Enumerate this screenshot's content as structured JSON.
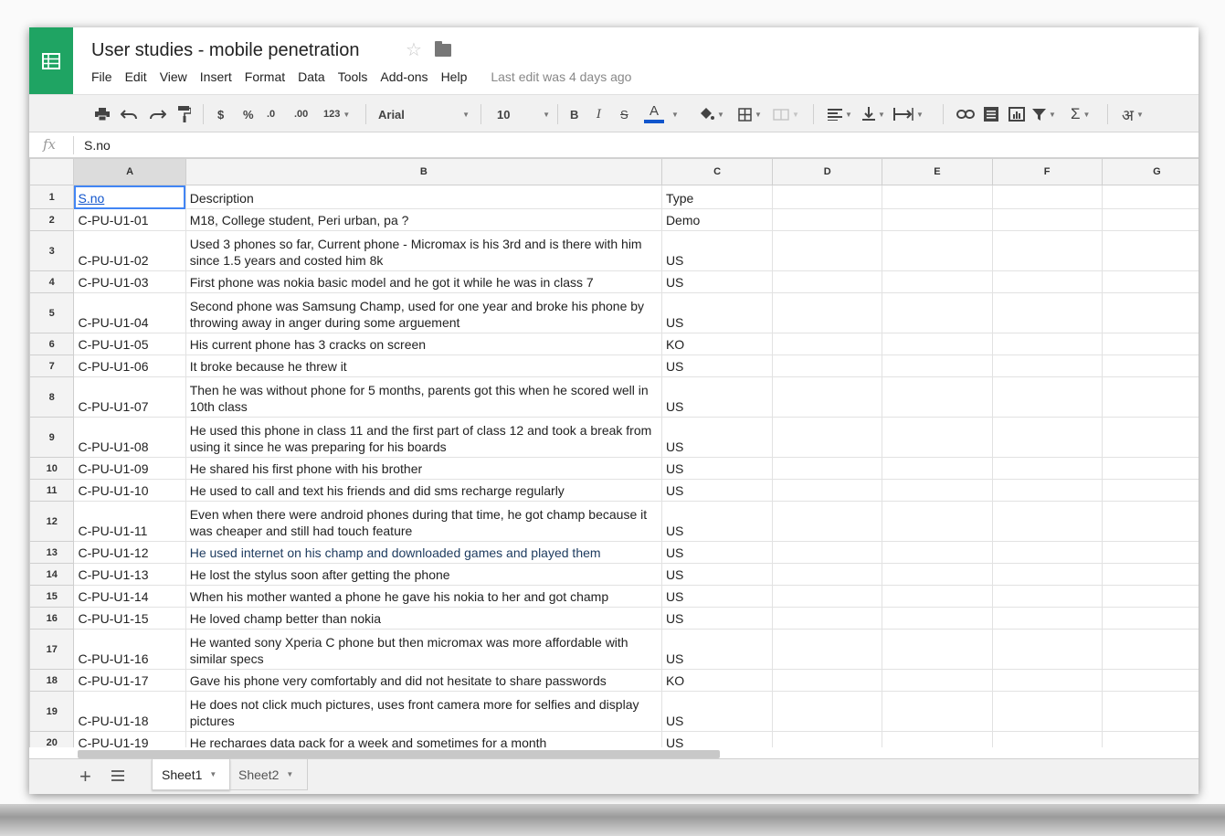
{
  "document": {
    "title": "User studies - mobile penetration"
  },
  "menu": {
    "items": [
      "File",
      "Edit",
      "View",
      "Insert",
      "Format",
      "Data",
      "Tools",
      "Add-ons",
      "Help"
    ],
    "last_edit": "Last edit was 4 days ago"
  },
  "toolbar": {
    "currency": "$",
    "percent": "%",
    "decimal_decrease": ".0",
    "decimal_increase": ".00",
    "number_format": "123",
    "font": "Arial",
    "font_size": "10",
    "bold": "B",
    "italic": "I",
    "strikethrough": "S",
    "text_color": "A",
    "sum": "Σ",
    "input_tools": "अ"
  },
  "formula_bar": {
    "fx": "fx",
    "value": "S.no"
  },
  "columns": [
    "A",
    "B",
    "C",
    "D",
    "E",
    "F",
    "G"
  ],
  "rows": [
    {
      "n": "1",
      "a": "S.no",
      "b": "Description",
      "c": "Type"
    },
    {
      "n": "2",
      "a": "C-PU-U1-01",
      "b": "M18, College student, Peri urban, pa ?",
      "c": "Demo"
    },
    {
      "n": "3",
      "a": "C-PU-U1-02",
      "b": "Used 3 phones so far, Current phone - Micromax is his 3rd and is there with him since 1.5 years and costed him 8k",
      "c": "US"
    },
    {
      "n": "4",
      "a": "C-PU-U1-03",
      "b": "First phone was nokia basic model and he got it while he was in class 7",
      "c": "US"
    },
    {
      "n": "5",
      "a": "C-PU-U1-04",
      "b": "Second phone was Samsung Champ, used for one year and broke his phone by throwing away in anger during some arguement",
      "c": "US"
    },
    {
      "n": "6",
      "a": "C-PU-U1-05",
      "b": "His current phone has 3 cracks on screen",
      "c": "KO"
    },
    {
      "n": "7",
      "a": "C-PU-U1-06",
      "b": "It broke because he threw it",
      "c": "US"
    },
    {
      "n": "8",
      "a": "C-PU-U1-07",
      "b": "Then he was without phone for 5 months, parents got this when he scored well in 10th class",
      "c": "US"
    },
    {
      "n": "9",
      "a": "C-PU-U1-08",
      "b": "He used this phone in class 11 and the first part of class 12 and took a break from using it since he was preparing for his boards",
      "c": "US"
    },
    {
      "n": "10",
      "a": "C-PU-U1-09",
      "b": "He shared his first phone with his brother",
      "c": "US"
    },
    {
      "n": "11",
      "a": "C-PU-U1-10",
      "b": "He used to call and text his friends and did sms recharge regularly",
      "c": "US"
    },
    {
      "n": "12",
      "a": "C-PU-U1-11",
      "b": "Even when there were android phones during that time, he got champ because it was cheaper and still had touch feature",
      "c": "US"
    },
    {
      "n": "13",
      "a": "C-PU-U1-12",
      "b": "He used internet on his champ and downloaded games and played them",
      "c": "US"
    },
    {
      "n": "14",
      "a": "C-PU-U1-13",
      "b": "He lost the stylus soon after getting the phone",
      "c": "US"
    },
    {
      "n": "15",
      "a": "C-PU-U1-14",
      "b": "When his mother wanted a phone he gave his nokia to her and got champ",
      "c": "US"
    },
    {
      "n": "16",
      "a": "C-PU-U1-15",
      "b": "He loved champ better than nokia",
      "c": "US"
    },
    {
      "n": "17",
      "a": "C-PU-U1-16",
      "b": "He wanted sony Xperia C phone but then micromax was more affordable with similar specs",
      "c": "US"
    },
    {
      "n": "18",
      "a": "C-PU-U1-17",
      "b": "Gave his phone very comfortably and did not hesitate to share passwords",
      "c": "KO"
    },
    {
      "n": "19",
      "a": "C-PU-U1-18",
      "b": "He does not click much pictures, uses front camera more for selfies and display pictures",
      "c": "US"
    },
    {
      "n": "20",
      "a": "C-PU-U1-19",
      "b": "He recharges data pack for a week and sometimes for a month",
      "c": "US"
    }
  ],
  "sheets": [
    "Sheet1",
    "Sheet2"
  ]
}
